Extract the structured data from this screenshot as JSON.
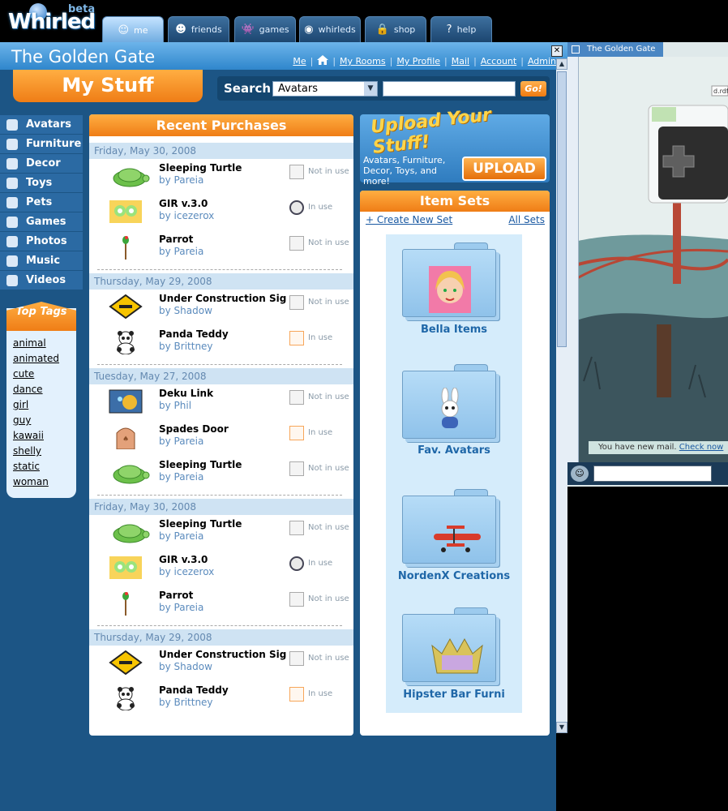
{
  "logo": {
    "text": "Whirled",
    "badge": "beta"
  },
  "nav_tabs": [
    {
      "label": "me",
      "icon": "me-icon",
      "glyph": "☺",
      "active": true
    },
    {
      "label": "friends",
      "icon": "friends-icon",
      "glyph": "☻",
      "active": false
    },
    {
      "label": "games",
      "icon": "games-icon",
      "glyph": "👾",
      "active": false
    },
    {
      "label": "whirleds",
      "icon": "whirleds-icon",
      "glyph": "◉",
      "active": false
    },
    {
      "label": "shop",
      "icon": "shop-icon",
      "glyph": "🔒",
      "active": false
    },
    {
      "label": "help",
      "icon": "help-icon",
      "glyph": "?",
      "active": false
    }
  ],
  "place_title": "The Golden Gate",
  "top_links": {
    "me": "Me",
    "home_icon": "home-icon",
    "my_rooms": "My Rooms",
    "my_profile": "My Profile",
    "mail": "Mail",
    "account": "Account",
    "admin": "Admin",
    "separator": "|"
  },
  "page_title": "My Stuff",
  "search": {
    "label": "Search",
    "category": "Avatars",
    "go": "Go!",
    "value": ""
  },
  "sidebar": {
    "items": [
      {
        "label": "Avatars",
        "icon": "avatars-icon"
      },
      {
        "label": "Furniture",
        "icon": "furniture-icon"
      },
      {
        "label": "Decor",
        "icon": "decor-icon"
      },
      {
        "label": "Toys",
        "icon": "toys-icon"
      },
      {
        "label": "Pets",
        "icon": "pets-icon"
      },
      {
        "label": "Games",
        "icon": "games-icon"
      },
      {
        "label": "Photos",
        "icon": "photos-icon"
      },
      {
        "label": "Music",
        "icon": "music-icon"
      },
      {
        "label": "Videos",
        "icon": "videos-icon"
      }
    ]
  },
  "top_tags": {
    "title": "Top Tags",
    "tags": [
      "animal",
      "animated",
      "cute",
      "dance",
      "girl",
      "guy",
      "kawaii",
      "shelly",
      "static",
      "woman"
    ]
  },
  "recent": {
    "title": "Recent Purchases",
    "groups": [
      {
        "date": "Friday, May 30, 2008",
        "items": [
          {
            "name": "Sleeping Turtle",
            "by": "by Pareia",
            "status": "Not in use",
            "thumb": "turtle"
          },
          {
            "name": "GIR v.3.0",
            "by": "by icezerox",
            "status": "In use",
            "thumb": "gir"
          },
          {
            "name": "Parrot",
            "by": "by Pareia",
            "status": "Not in use",
            "thumb": "parrot"
          }
        ]
      },
      {
        "date": "Thursday, May 29, 2008",
        "items": [
          {
            "name": "Under Construction Sig",
            "by": "by Shadow",
            "status": "Not in use",
            "thumb": "sign"
          },
          {
            "name": "Panda Teddy",
            "by": "by Brittney",
            "status": "In use",
            "thumb": "panda"
          }
        ]
      },
      {
        "date": "Tuesday, May 27, 2008",
        "items": [
          {
            "name": "Deku Link",
            "by": "by Phil",
            "status": "Not in use",
            "thumb": "deku"
          },
          {
            "name": "Spades Door",
            "by": "by Pareia",
            "status": "In use",
            "thumb": "door"
          },
          {
            "name": "Sleeping Turtle",
            "by": "by Pareia",
            "status": "Not in use",
            "thumb": "turtle"
          }
        ]
      },
      {
        "date": "Friday, May 30, 2008",
        "items": [
          {
            "name": "Sleeping Turtle",
            "by": "by Pareia",
            "status": "Not in use",
            "thumb": "turtle"
          },
          {
            "name": "GIR v.3.0",
            "by": "by icezerox",
            "status": "In use",
            "thumb": "gir"
          },
          {
            "name": "Parrot",
            "by": "by Pareia",
            "status": "Not in use",
            "thumb": "parrot"
          }
        ]
      },
      {
        "date": "Thursday, May 29, 2008",
        "items": [
          {
            "name": "Under Construction Sig",
            "by": "by Shadow",
            "status": "Not in use",
            "thumb": "sign"
          },
          {
            "name": "Panda Teddy",
            "by": "by Brittney",
            "status": "In use",
            "thumb": "panda"
          }
        ]
      }
    ]
  },
  "upload": {
    "title": "Upload Your Stuff!",
    "description": "Avatars, Furniture, Decor, Toys, and more!",
    "button": "UPLOAD"
  },
  "item_sets": {
    "title": "Item Sets",
    "create": "+ Create New Set",
    "all": "All Sets",
    "sets": [
      {
        "label": "Bella Items",
        "pic": "bella"
      },
      {
        "label": "Fav. Avatars",
        "pic": "rabbid"
      },
      {
        "label": "NordenX Creations",
        "pic": "plane"
      },
      {
        "label": "Hipster Bar Furni",
        "pic": "crown"
      }
    ]
  },
  "world": {
    "tab_title": "The Golden Gate",
    "mail_text": "You have new mail.",
    "mail_link": "Check now",
    "room_file": "d.rdf"
  },
  "colors": {
    "orange": "#ef7d16",
    "blue_bg": "#1c5585",
    "link": "#1a59a2",
    "date_text": "#6489b0"
  }
}
